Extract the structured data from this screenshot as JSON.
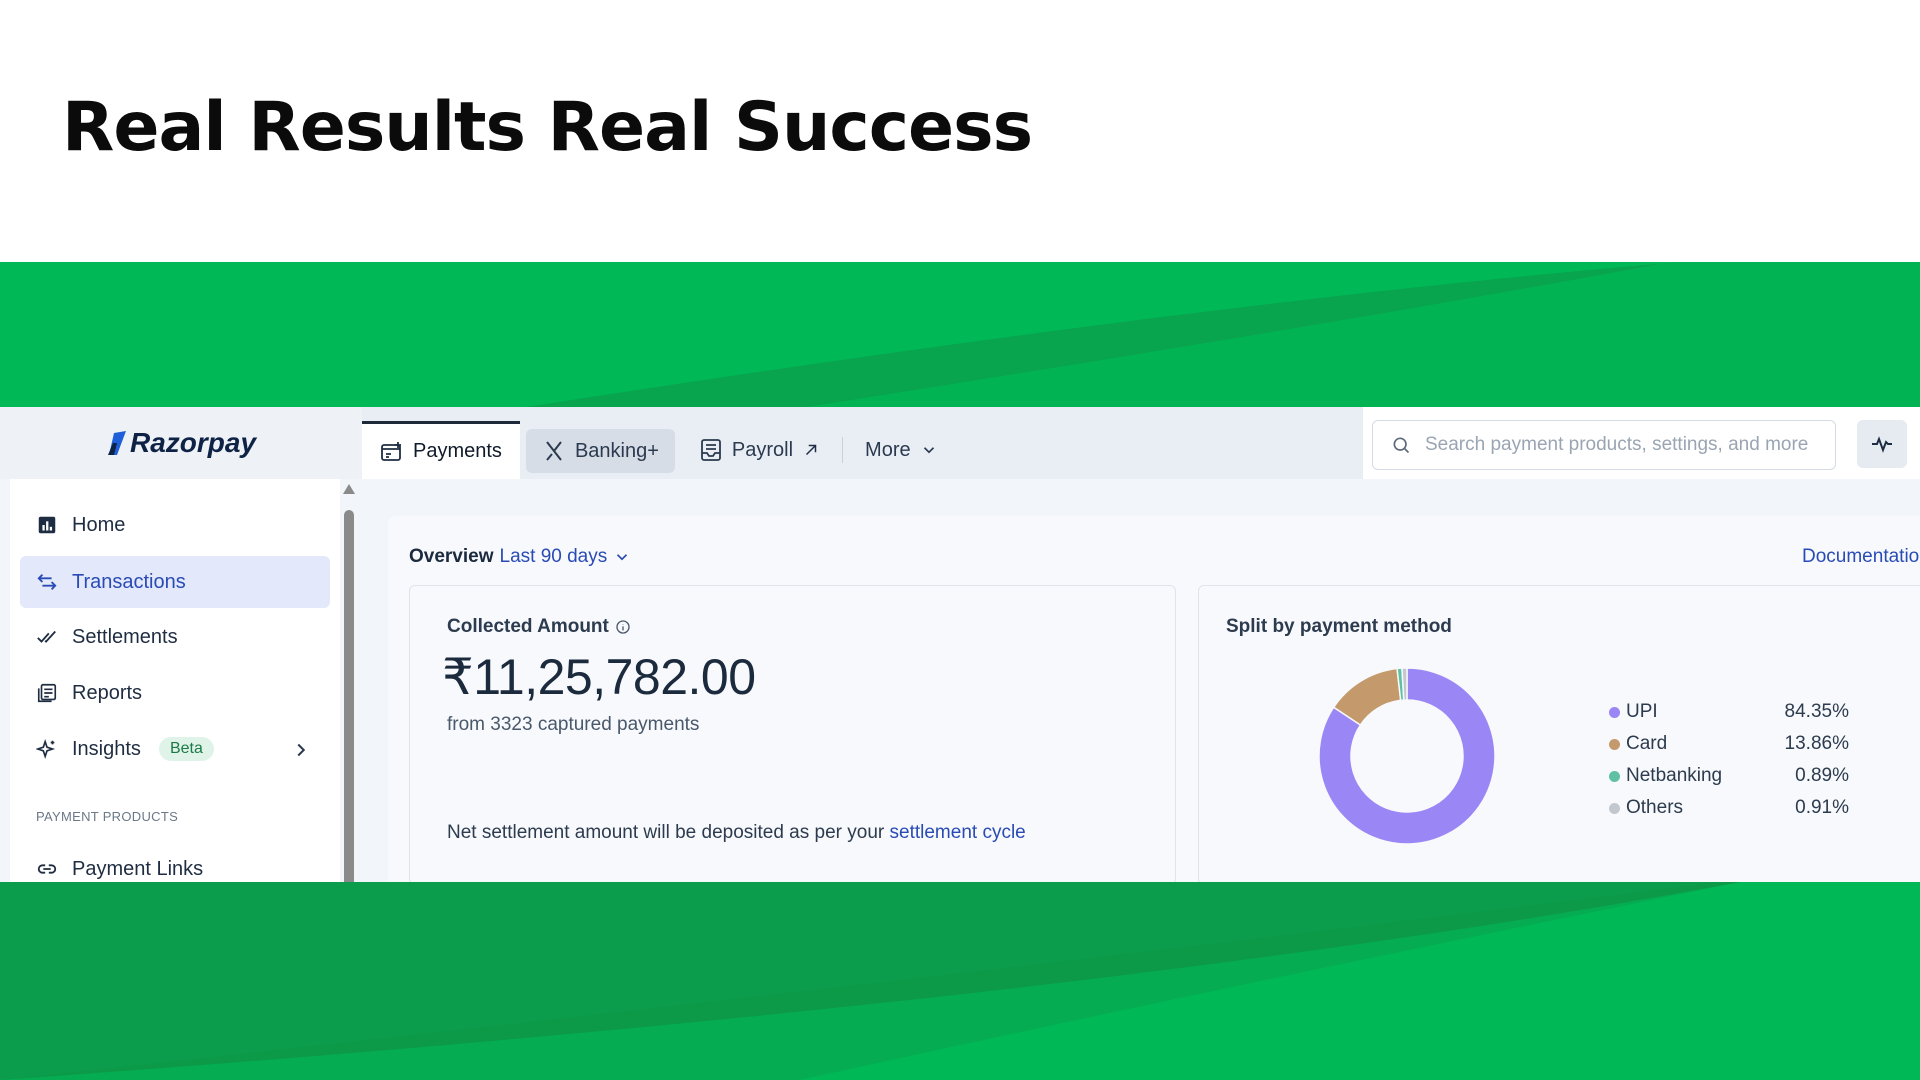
{
  "headline": "Real Results Real Success",
  "colors": {
    "green": "#00b956",
    "green_dark": "#0f9448",
    "accent_blue": "#2a4bb5",
    "upi": "#9a86f5",
    "card": "#c49a6c",
    "netbanking": "#5fc0a4",
    "others": "#c3c8cf"
  },
  "app": {
    "logo": "Razorpay",
    "tabs": [
      {
        "label": "Payments",
        "icon": "payments-icon",
        "active": true
      },
      {
        "label": "Banking+",
        "icon": "banking-x-icon"
      },
      {
        "label": "Payroll",
        "icon": "payroll-icon",
        "external_icon": "arrow-up-right-icon"
      },
      {
        "label": "More",
        "icon": "chevron-down-icon"
      }
    ],
    "search": {
      "placeholder": "Search payment products, settings, and more",
      "icon": "search-icon"
    },
    "activity_icon": "pulse-icon",
    "sidebar": {
      "items": [
        {
          "label": "Home",
          "icon": "home-chart-icon"
        },
        {
          "label": "Transactions",
          "icon": "transfer-arrows-icon",
          "selected": true
        },
        {
          "label": "Settlements",
          "icon": "double-check-icon"
        },
        {
          "label": "Reports",
          "icon": "reports-icon"
        },
        {
          "label": "Insights",
          "icon": "sparkle-icon",
          "badge": "Beta"
        }
      ],
      "section_label": "PAYMENT PRODUCTS",
      "section_items": [
        {
          "label": "Payment Links",
          "icon": "link-icon"
        }
      ]
    },
    "overview": {
      "label": "Overview",
      "range": "Last 90 days",
      "doc_link": "Documentation"
    },
    "collected": {
      "title": "Collected Amount",
      "amount": "₹11,25,782.00",
      "sub": "from 3323 captured payments",
      "note": "Net settlement amount will be deposited as per your",
      "note_link": "settlement cycle"
    },
    "split": {
      "title": "Split by payment method",
      "methods": [
        {
          "name": "UPI",
          "value": "84.35%"
        },
        {
          "name": "Card",
          "value": "13.86%"
        },
        {
          "name": "Netbanking",
          "value": "0.89%"
        },
        {
          "name": "Others",
          "value": "0.91%"
        }
      ]
    }
  },
  "chart_data": {
    "type": "pie",
    "title": "Split by payment method",
    "categories": [
      "UPI",
      "Card",
      "Netbanking",
      "Others"
    ],
    "values": [
      84.35,
      13.86,
      0.89,
      0.91
    ]
  }
}
